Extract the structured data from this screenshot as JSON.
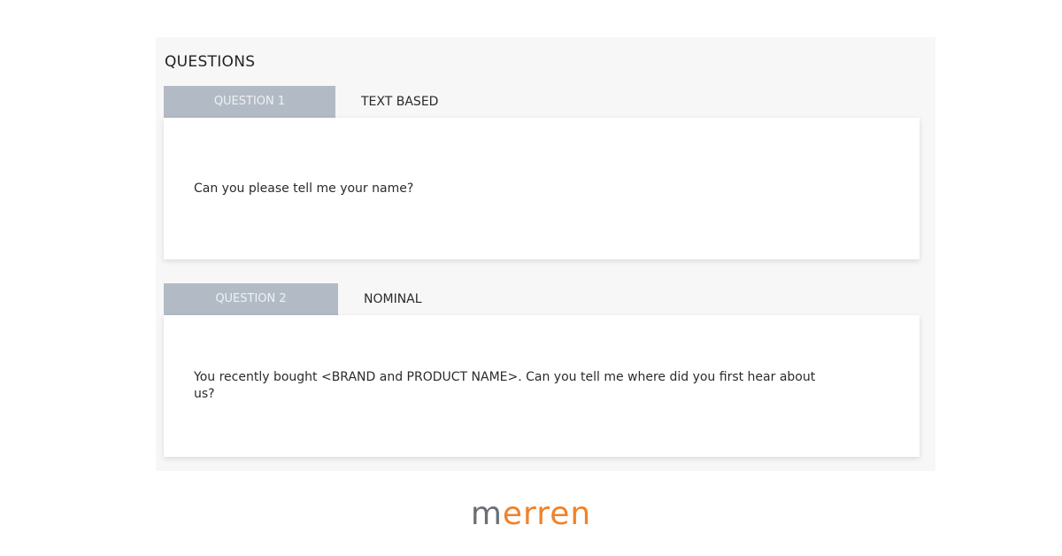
{
  "section": {
    "title": "QUESTIONS"
  },
  "questions": [
    {
      "tab_label": "QUESTION 1",
      "type": "TEXT BASED",
      "text": "Can you please tell me your name?"
    },
    {
      "tab_label": "QUESTION 2",
      "type": "NOMINAL",
      "text": "You recently bought <BRAND and PRODUCT NAME>. Can you tell me where did you first hear about us?"
    }
  ],
  "logo": {
    "first": "m",
    "rest": "erren"
  },
  "colors": {
    "tab_bg": "#b2bbc5",
    "logo_gray": "#6b6f73",
    "logo_orange": "#f0822a"
  }
}
